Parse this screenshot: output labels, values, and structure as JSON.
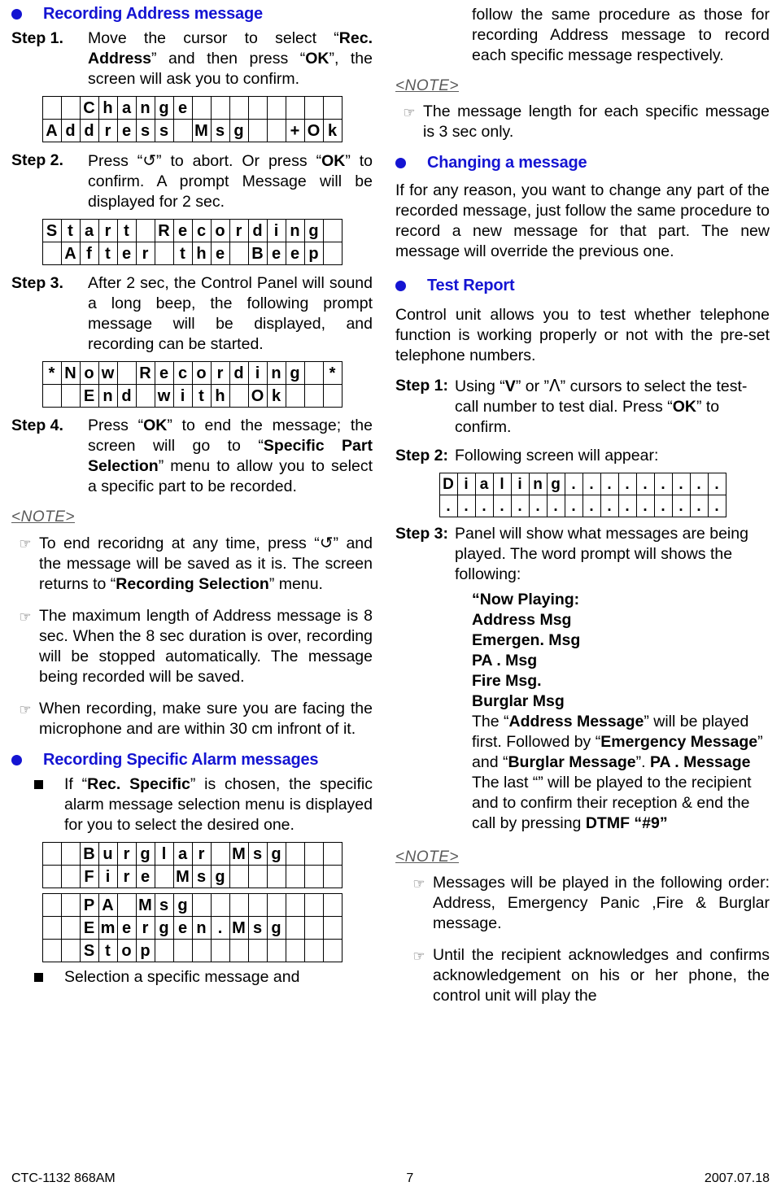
{
  "colors": {
    "heading_blue": "#1414d2",
    "note_gray": "#5a5a5a",
    "text": "#000000"
  },
  "left_column": {
    "heading": "Recording Address message",
    "step1": {
      "label": "Step  1.",
      "text_pre": "Move the cursor to select “",
      "bold1": "Rec. Address",
      "text_mid": "” and then press “",
      "bold2": "OK",
      "text_post": "”, the screen will ask you to confirm."
    },
    "lcd1": {
      "row1": [
        "",
        "",
        "C",
        "h",
        "a",
        "n",
        "g",
        "e",
        "",
        "",
        "",
        "",
        "",
        "",
        "",
        ""
      ],
      "row2": [
        "A",
        "d",
        "d",
        "r",
        "e",
        "s",
        "s",
        "",
        "M",
        "s",
        "g",
        "",
        "",
        "+",
        "O",
        "k"
      ]
    },
    "step2": {
      "label": "Step 2.",
      "text_pre": "Press “",
      "glyph": "↺",
      "text_mid": "” to abort. Or press “",
      "bold1": "OK",
      "text_post": "” to confirm. A prompt Message will be displayed for 2 sec."
    },
    "lcd2": {
      "row1": [
        "S",
        "t",
        "a",
        "r",
        "t",
        "",
        "R",
        "e",
        "c",
        "o",
        "r",
        "d",
        "i",
        "n",
        "g",
        ""
      ],
      "row2": [
        "",
        "A",
        "f",
        "t",
        "e",
        "r",
        "",
        "t",
        "h",
        "e",
        "",
        "B",
        "e",
        "e",
        "p",
        ""
      ]
    },
    "step3": {
      "label": "Step 3.",
      "text": "After 2 sec, the Control Panel will sound a long beep, the following prompt message will be displayed, and recording can be started."
    },
    "lcd3": {
      "row1": [
        "*",
        "N",
        "o",
        "w",
        "",
        "R",
        "e",
        "c",
        "o",
        "r",
        "d",
        "i",
        "n",
        "g",
        "",
        "*"
      ],
      "row2": [
        "",
        "",
        "E",
        "n",
        "d",
        "",
        "w",
        "i",
        "t",
        "h",
        "",
        "O",
        "k",
        "",
        "",
        ""
      ]
    },
    "step4": {
      "label": "Step 4.",
      "text_pre": "Press “",
      "bold1": "OK",
      "text_mid": "” to end the message; the screen will go to “",
      "bold2": "Specific Part Selection",
      "text_post": "” menu to allow you to select a specific part to be recorded."
    },
    "note_label": "<NOTE>",
    "notes": [
      {
        "text_pre": "To end recoridng at any time, press “",
        "glyph": "↺",
        "text_mid": "” and the message will be saved as it is. The screen returns to “",
        "bold1": "Recording Selection",
        "text_post": "” menu."
      },
      {
        "text": "The maximum length of Address message is 8 sec.  When the 8 sec duration is over, recording will be stopped automatically.  The message being recorded will be saved."
      },
      {
        "text": "When recording, make sure you are facing the microphone and are within 30 cm infront of it."
      }
    ],
    "heading2": "Recording Specific Alarm messages",
    "square_item1": {
      "text_pre": "If “",
      "bold1": "Rec. Specific",
      "text_post": "” is chosen, the specific alarm message selection menu is displayed for you to select the desired one."
    },
    "lcd4": {
      "row1": [
        "",
        "",
        "B",
        "u",
        "r",
        "g",
        "l",
        "a",
        "r",
        "",
        "M",
        "s",
        "g",
        "",
        "",
        ""
      ],
      "row2": [
        "",
        "",
        "F",
        "i",
        "r",
        "e",
        "",
        "M",
        "s",
        "g",
        "",
        "",
        "",
        "",
        "",
        ""
      ]
    },
    "lcd5": {
      "row1": [
        "",
        "",
        "P",
        "A",
        "",
        "M",
        "s",
        "g",
        "",
        "",
        "",
        "",
        "",
        "",
        "",
        ""
      ],
      "row2": [
        "",
        "",
        "E",
        "m",
        "e",
        "r",
        "g",
        "e",
        "n",
        ".",
        "M",
        "s",
        "g",
        "",
        "",
        ""
      ],
      "row3": [
        "",
        "",
        "S",
        "t",
        "o",
        "p",
        "",
        "",
        "",
        "",
        "",
        "",
        "",
        "",
        "",
        ""
      ]
    },
    "square_item2": {
      "text": "Selection a specific message and"
    }
  },
  "right_column": {
    "intro": "follow the same procedure as those for recording Address message to record each specific message respectively.",
    "note_label_1": "<NOTE>",
    "note_1": "The message length for each specific message is 3 sec only.",
    "heading_changing": "Changing a message",
    "changing_text": "If for any reason, you want to change any part of the recorded message, just follow the same procedure to record a new message for that part.   The new message will override the previous one.",
    "heading_test": "Test Report",
    "test_text": "Control unit allows you to test whether telephone function is working properly or not with the pre-set telephone numbers.",
    "step1": {
      "label": "Step 1:",
      "text_pre": "Using “",
      "bold1": "V",
      "text_mid": "” or ”",
      "glyph": "Λ",
      "text_mid2": "” cursors to select the test-call number to test dial. Press “",
      "bold2": "OK",
      "text_post": "” to confirm."
    },
    "step2": {
      "label": "Step 2:",
      "text": "Following screen will appear:"
    },
    "lcd_dialing": {
      "row1": [
        "D",
        "i",
        "a",
        "l",
        "i",
        "n",
        "g",
        ".",
        ".",
        ".",
        ".",
        ".",
        ".",
        ".",
        ".",
        "."
      ],
      "row2": [
        ".",
        ".",
        ".",
        ".",
        ".",
        ".",
        ".",
        ".",
        ".",
        ".",
        ".",
        ".",
        ".",
        ".",
        ".",
        "."
      ]
    },
    "step3": {
      "label": "Step 3:",
      "text": "Panel will show what messages are being played. The word prompt will shows the following:"
    },
    "now_playing": [
      "“Now Playing:",
      "Address  Msg",
      "Emergen. Msg",
      "PA  . Msg",
      "Fire Msg.",
      "Burglar  Msg"
    ],
    "played_order": {
      "t1": "The “",
      "b1": "Address Message",
      "t2": "” will be played first. Followed by “",
      "b2": "Emergency Message",
      "t3": "” and “",
      "b3": "Burglar Message",
      "t4": "”. ",
      "b4": "PA  . Message",
      "t5": " The last “” will be played to the recipient and to confirm their reception & end the call by pressing ",
      "b5": "DTMF “#9”"
    },
    "note_label_2": "<NOTE>",
    "notes": [
      {
        "text": "Messages will be played in the following order: Address, Emergency Panic ,Fire & Burglar message."
      },
      {
        "text": "Until the recipient acknowledges and confirms acknowledgement on his or her phone, the control unit will play the"
      }
    ]
  },
  "footer": {
    "left": "CTC-1132 868AM",
    "page": "7",
    "right": "2007.07.18"
  }
}
